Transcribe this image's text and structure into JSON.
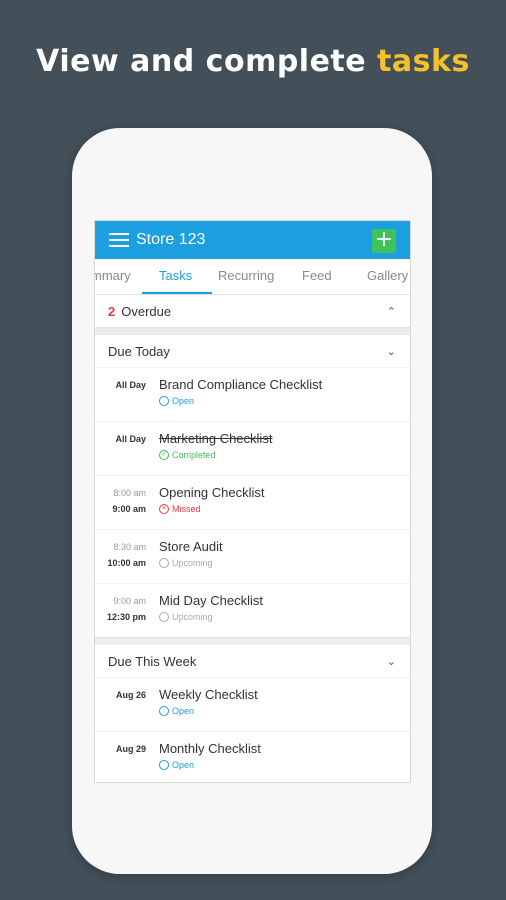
{
  "headline": {
    "text": "View and complete ",
    "accent": "tasks",
    "accent_color": "#f5c02b"
  },
  "appbar": {
    "title": "Store 123",
    "add_label": "+",
    "color": "#1c9fe0",
    "add_color": "#3ec35a"
  },
  "tabs": [
    {
      "label": "Summary",
      "visible_label": "mmary"
    },
    {
      "label": "Tasks",
      "active": true
    },
    {
      "label": "Recurring"
    },
    {
      "label": "Feed"
    },
    {
      "label": "Gallery"
    }
  ],
  "overdue": {
    "count": "2",
    "label": "Overdue",
    "collapsed_icon": "chevron-up-icon"
  },
  "due_today": {
    "title": "Due Today",
    "tasks": [
      {
        "time1": "All Day",
        "time2": "",
        "name": "Brand Compliance Checklist",
        "status": "Open",
        "status_icon": "open-circle-icon"
      },
      {
        "time1": "All Day",
        "time2": "",
        "name": "Marketing Checklist",
        "status": "Completed",
        "status_icon": "check-circle-icon"
      },
      {
        "time1": "8:00 am",
        "time2": "9:00 am",
        "name": "Opening Checklist",
        "status": "Missed",
        "status_icon": "x-circle-icon"
      },
      {
        "time1": "8:30 am",
        "time2": "10:00 am",
        "name": "Store Audit",
        "status": "Upcoming",
        "status_icon": "upcoming-circle-icon"
      },
      {
        "time1": "9:00 am",
        "time2": "12:30 pm",
        "name": "Mid Day Checklist",
        "status": "Upcoming",
        "status_icon": "upcoming-circle-icon"
      }
    ]
  },
  "due_this_week": {
    "title": "Due This Week",
    "tasks": [
      {
        "time1": "Aug 26",
        "name": "Weekly Checklist",
        "status": "Open"
      },
      {
        "time1": "Aug 29",
        "name": "Monthly Checklist",
        "status": "Open"
      }
    ]
  }
}
